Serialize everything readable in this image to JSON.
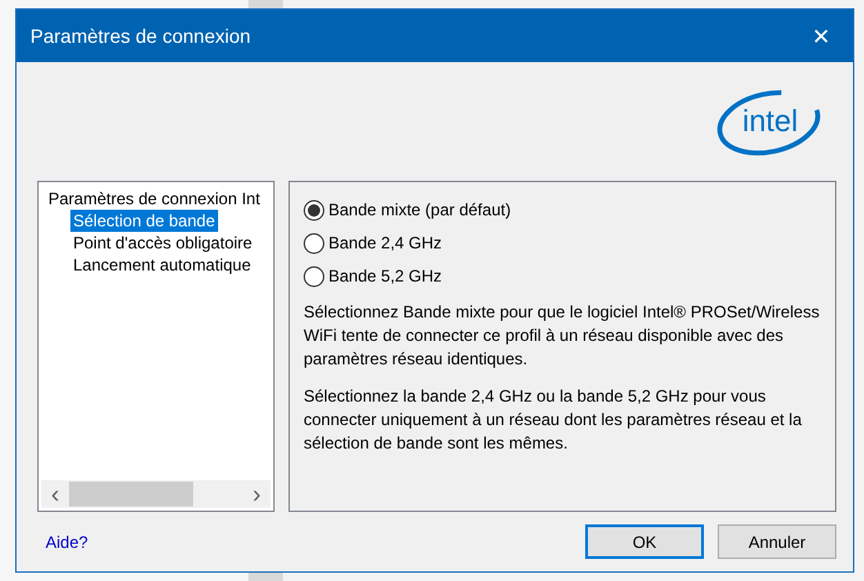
{
  "window": {
    "title": "Paramètres de connexion",
    "close": "✕"
  },
  "logo": "intel",
  "tree": [
    {
      "label": "Paramètres de connexion Int",
      "selected": false,
      "children": [
        {
          "label": "Sélection de bande",
          "selected": true
        },
        {
          "label": "Point d'accès obligatoire",
          "selected": false
        },
        {
          "label": "Lancement automatique",
          "selected": false
        }
      ]
    }
  ],
  "scrollbar": {
    "left": "‹",
    "right": "›"
  },
  "band_options": [
    {
      "label": "Bande mixte (par défaut)",
      "selected": true
    },
    {
      "label": "Bande 2,4 GHz",
      "selected": false
    },
    {
      "label": "Bande 5,2 GHz",
      "selected": false
    }
  ],
  "descriptions": [
    "Sélectionnez Bande mixte pour que le logiciel Intel® PROSet/Wireless WiFi tente de connecter ce profil à un réseau disponible avec des paramètres réseau identiques.",
    "Sélectionnez la bande 2,4 GHz ou la bande 5,2 GHz pour vous connecter uniquement à un réseau dont les paramètres réseau et la sélection de bande sont les mêmes."
  ],
  "help_link": "Aide?",
  "buttons": [
    {
      "label": "OK",
      "default": true
    },
    {
      "label": "Annuler",
      "default": false
    }
  ]
}
